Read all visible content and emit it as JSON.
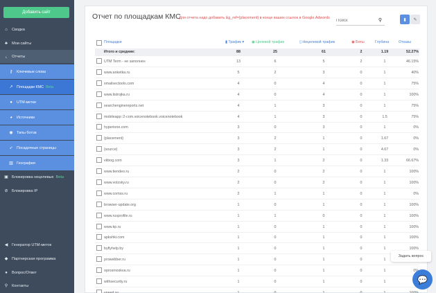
{
  "sidebar": {
    "add_site": "Добавить сайт",
    "items": [
      {
        "label": "Сводка",
        "icon": "home-icon"
      },
      {
        "label": "Мои сайты",
        "icon": "sitemap-icon"
      },
      {
        "label": "Отчеты",
        "icon": "chart-icon"
      }
    ],
    "subitems": [
      {
        "label": "Ключевые слова",
        "icon": "key-icon"
      },
      {
        "label": "Площадки КМС",
        "beta": "Beta",
        "icon": "external-link-icon"
      },
      {
        "label": "UTM-метки",
        "icon": "tags-icon"
      },
      {
        "label": "Источники",
        "icon": "pie-chart-icon"
      },
      {
        "label": "Типы ботов",
        "icon": "robot-icon"
      },
      {
        "label": "Посадочные страницы",
        "icon": "rocket-icon"
      },
      {
        "label": "География",
        "icon": "map-icon"
      }
    ],
    "bottom_items": [
      {
        "label": "Блокировка нецелевых",
        "beta": "Beta",
        "icon": "lock-icon"
      },
      {
        "label": "Блокировка IP",
        "icon": "ban-icon"
      }
    ],
    "footer_items": [
      {
        "label": "Генератор UTM-меток",
        "icon": "bullhorn-icon"
      },
      {
        "label": "Партнерская программа",
        "icon": "handshake-icon"
      },
      {
        "label": "Вопрос/Ответ",
        "icon": "comments-icon"
      },
      {
        "label": "Контакты",
        "icon": "map-marker-icon"
      }
    ]
  },
  "header": {
    "title": "Отчет по площадкам КМС",
    "warning": "Для отчета надо добавить &g_ref={placement} в конце ваших ссылок в Google.Adwords",
    "search_placeholder": "Поиск"
  },
  "table": {
    "headers": [
      "Площадки",
      "Трафик",
      "Целевой трафик",
      "Нецелевой трафик",
      "Боты",
      "Глубина",
      "Отказы"
    ],
    "total": [
      "Итого и средние:",
      "88",
      "25",
      "61",
      "2",
      "1.19",
      "52.27%"
    ],
    "rows": [
      [
        "UTM Term - не заполнен",
        "13",
        "6",
        "5",
        "2",
        "1",
        "46.15%"
      ],
      [
        "www.anketka.ru",
        "5",
        "2",
        "3",
        "0",
        "1",
        "40%"
      ],
      [
        "smailsectools.com",
        "4",
        "0",
        "4",
        "0",
        "1",
        "75%"
      ],
      [
        "www.listrojka.ru",
        "4",
        "0",
        "4",
        "0",
        "1",
        "100%"
      ],
      [
        "searchenginereports.net",
        "4",
        "1",
        "3",
        "0",
        "1",
        "75%"
      ],
      [
        "mobileapp::2-com.voicenotebook.voicenotebook",
        "4",
        "1",
        "3",
        "0",
        "1.5",
        "75%"
      ],
      [
        "hyperione.com",
        "3",
        "0",
        "3",
        "0",
        "1",
        "0%"
      ],
      [
        "{placement}",
        "3",
        "2",
        "1",
        "0",
        "1.67",
        "0%"
      ],
      [
        "{source}",
        "3",
        "2",
        "1",
        "0",
        "4.67",
        "0%"
      ],
      [
        "vkbog.com",
        "3",
        "1",
        "2",
        "0",
        "1.33",
        "66.67%"
      ],
      [
        "www.tiendeo.ru",
        "2",
        "0",
        "2",
        "0",
        "1",
        "100%"
      ],
      [
        "www.volzsky.ru",
        "2",
        "0",
        "2",
        "0",
        "1",
        "100%"
      ],
      [
        "www.comss.ru",
        "2",
        "1",
        "1",
        "0",
        "1",
        "0%"
      ],
      [
        "browser-update.org",
        "1",
        "0",
        "1",
        "0",
        "1",
        "100%"
      ],
      [
        "www.rusprofile.ru",
        "1",
        "1",
        "0",
        "0",
        "1",
        "100%"
      ],
      [
        "www.kp.ru",
        "1",
        "0",
        "1",
        "0",
        "1",
        "100%"
      ],
      [
        "apkshki.com",
        "1",
        "0",
        "1",
        "0",
        "1",
        "100%"
      ],
      [
        "byflyhelp.by",
        "1",
        "0",
        "1",
        "0",
        "1",
        "100%"
      ],
      [
        "prowebber.ru",
        "1",
        "0",
        "1",
        "0",
        "1",
        "0%"
      ],
      [
        "oprosmoskva.ru",
        "1",
        "0",
        "1",
        "0",
        "1",
        "0%"
      ],
      [
        "withsecurity.ru",
        "1",
        "0",
        "1",
        "0",
        "1",
        "0%"
      ],
      [
        "speed.su",
        "1",
        "0",
        "1",
        "0",
        "1",
        "100%"
      ]
    ]
  },
  "chat": {
    "tooltip": "Задать вопрос"
  }
}
